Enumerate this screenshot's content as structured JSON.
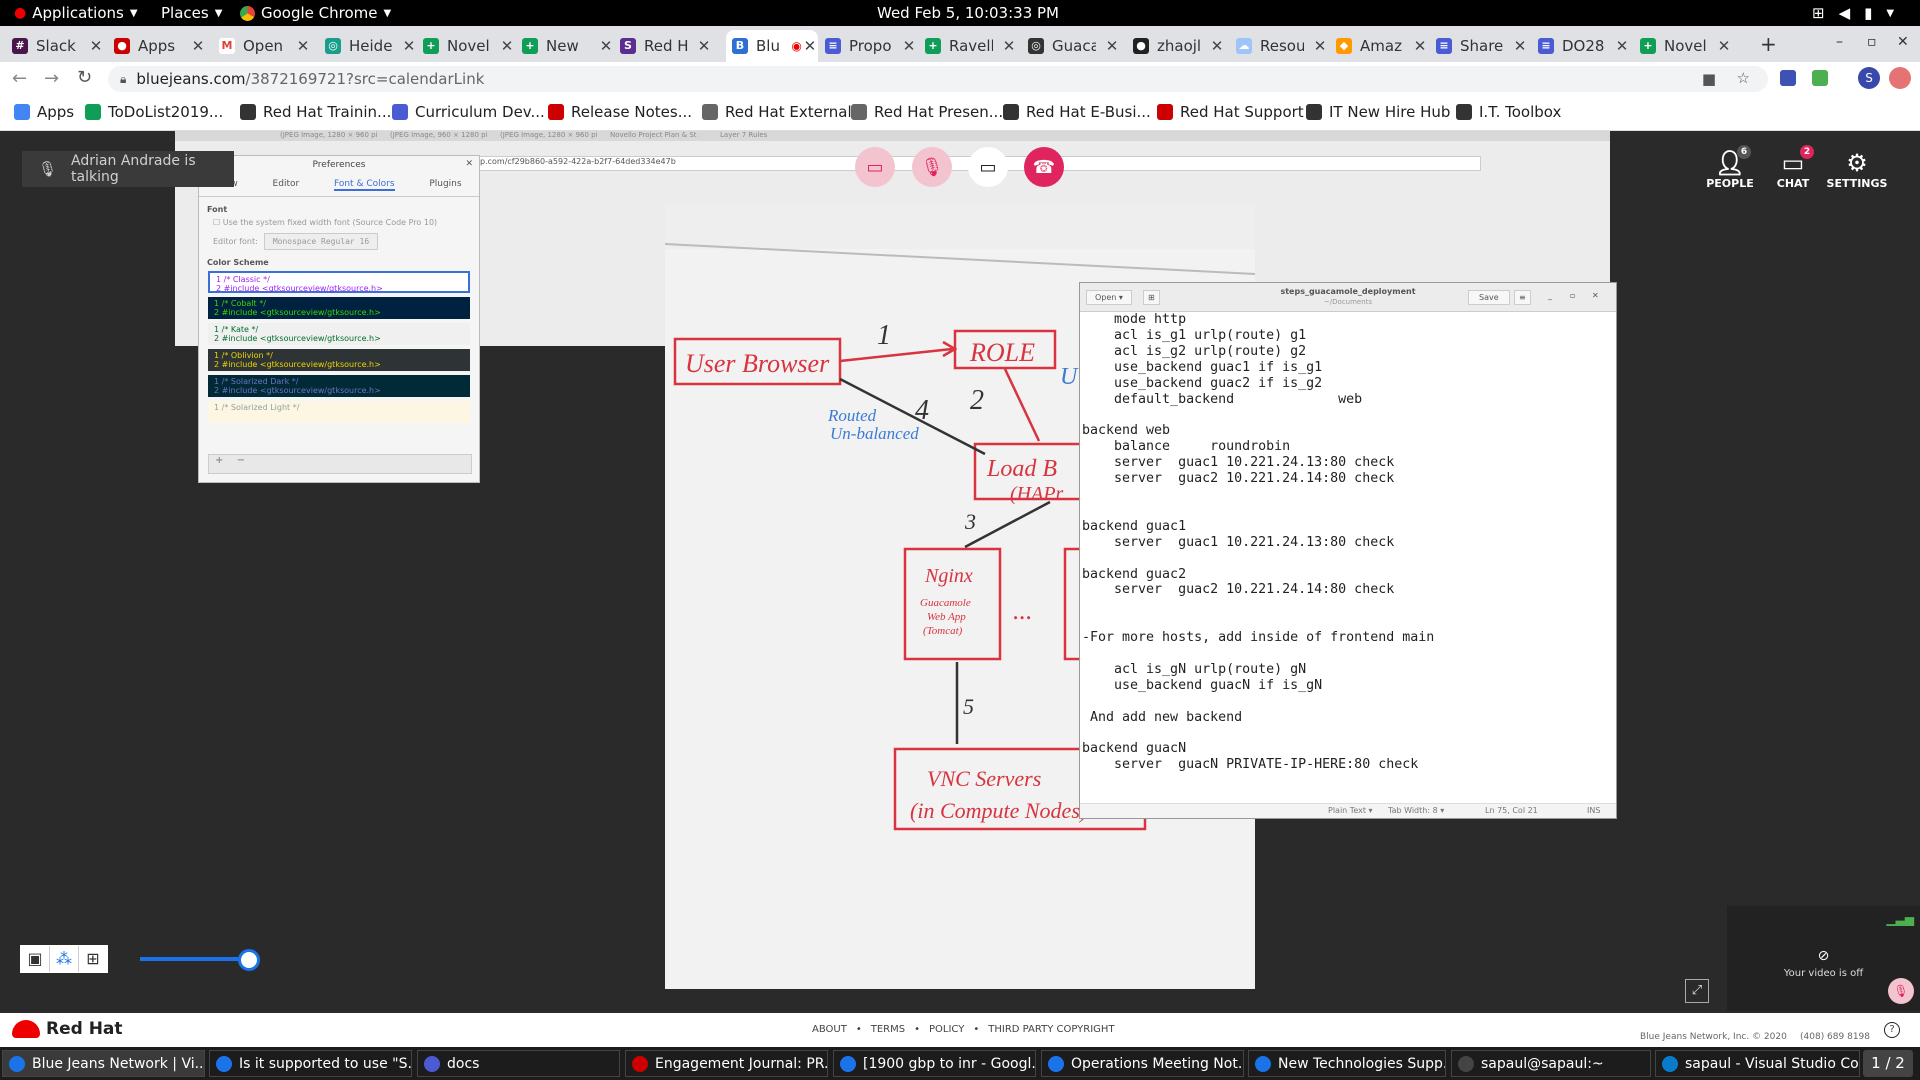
{
  "gnome": {
    "applications": "Applications",
    "places": "Places",
    "app": "Google Chrome",
    "clock": "Wed Feb  5, 10:03:33 PM"
  },
  "tabs": [
    {
      "label": "Slack",
      "color": "#4a154b",
      "glyph": "#"
    },
    {
      "label": "Apps",
      "color": "#cc0000",
      "glyph": "●"
    },
    {
      "label": "Open",
      "color": "#ffffff",
      "glyph": "M"
    },
    {
      "label": "Heide",
      "color": "#1a9e8a",
      "glyph": "◎"
    },
    {
      "label": "Novel",
      "color": "#0f9d58",
      "glyph": "+"
    },
    {
      "label": "New",
      "color": "#0f9d58",
      "glyph": "+"
    },
    {
      "label": "Red H",
      "color": "#5c2d91",
      "glyph": "S"
    },
    {
      "label": "Blu",
      "color": "#2d6fd3",
      "glyph": "B"
    },
    {
      "label": "Propo",
      "color": "#4a5bd4",
      "glyph": "≡"
    },
    {
      "label": "Ravell",
      "color": "#0f9d58",
      "glyph": "+"
    },
    {
      "label": "Guaca",
      "color": "#333333",
      "glyph": "◎"
    },
    {
      "label": "zhaojl",
      "color": "#222222",
      "glyph": "●"
    },
    {
      "label": "Resou",
      "color": "#9fc5f8",
      "glyph": "☁"
    },
    {
      "label": "Amaz",
      "color": "#ff9900",
      "glyph": "◆"
    },
    {
      "label": "Share",
      "color": "#4a5bd4",
      "glyph": "≡"
    },
    {
      "label": "DO28",
      "color": "#4a5bd4",
      "glyph": "≡"
    },
    {
      "label": "Novel",
      "color": "#0f9d58",
      "glyph": "+"
    }
  ],
  "url": {
    "host": "bluejeans.com",
    "path": "/387216972​1?src=calendarLink"
  },
  "bookmarks": [
    {
      "label": "Apps",
      "color": "#4285f4"
    },
    {
      "label": "ToDoList2019...",
      "color": "#0f9d58"
    },
    {
      "label": "Red Hat Trainin...",
      "color": "#333333"
    },
    {
      "label": "Curriculum Dev...",
      "color": "#4a5bd4"
    },
    {
      "label": "Release Notes...",
      "color": "#cc0000"
    },
    {
      "label": "Red Hat External",
      "color": "#666666"
    },
    {
      "label": "Red Hat Presen...",
      "color": "#666666"
    },
    {
      "label": "Red Hat E-Busi...",
      "color": "#333333"
    },
    {
      "label": "Red Hat Support",
      "color": "#cc0000"
    },
    {
      "label": "IT New Hire Hub",
      "color": "#333333"
    },
    {
      "label": "I.T. Toolbox",
      "color": "#333333"
    }
  ],
  "meeting": {
    "talking": "Adrian Andrade is talking",
    "people": "PEOPLE",
    "people_count": "6",
    "chat": "CHAT",
    "chat_count": "2",
    "settings": "SETTINGS",
    "video_off": "Your video is off"
  },
  "shared": {
    "inner_tabs": [
      "(JPEG Image, 1280 × 960 pi",
      "(JPEG Image, 960 × 1280 pi",
      "(JPEG Image, 1280 × 960 pi",
      "Novello Project Plan & St",
      "Layer 7 Rules"
    ],
    "inner_url": "p.com/cf29b860-a592-422a-b2f7-64ded334e47b",
    "prefs": {
      "title": "Preferences",
      "tabs": [
        "View",
        "Editor",
        "Font & Colors",
        "Plugins"
      ],
      "font_heading": "Font",
      "system_font": "Use the system fixed width font (Source Code Pro 10)",
      "editor_font_label": "Editor font:",
      "editor_font_value": "Monospace Regular  16",
      "scheme_heading": "Color Scheme",
      "schemes": [
        {
          "l1": "1 /* Classic */",
          "l2": "2 #include <gtksourceview/gtksource.h>",
          "bg": "#ffffff",
          "fg": "#a020f0"
        },
        {
          "l1": "1 /* Cobalt */",
          "l2": "2 #include <gtksourceview/gtksource.h>",
          "bg": "#002240",
          "fg": "#3ad900"
        },
        {
          "l1": "1 /* Kate */",
          "l2": "2 #include <gtksourceview/gtksource.h>",
          "bg": "#f0f0f0",
          "fg": "#006e28"
        },
        {
          "l1": "1 /* Oblivion */",
          "l2": "2 #include <gtksourceview/gtksource.h>",
          "bg": "#2e3436",
          "fg": "#edd400"
        },
        {
          "l1": "1 /* Solarized Dark */",
          "l2": "2 #include <gtksourceview/gtksource.h>",
          "bg": "#002b36",
          "fg": "#6c71c4"
        },
        {
          "l1": "1 /* Solarized Light */",
          "l2": "",
          "bg": "#fdf6e3",
          "fg": "#93a1a1"
        }
      ]
    },
    "whiteboard": {
      "user_browser": "User Browser",
      "role": "ROLE",
      "load_balancer": "Load B",
      "load_balancer_sub": "(HAPr",
      "nginx": "Nginx",
      "nginx_sub1": "Guacamole",
      "nginx_sub2": "Web App",
      "nginx_sub3": "(Tomcat)",
      "ellipsis": "...",
      "vnc1": "VNC Servers",
      "vnc2": "(in Compute Nodes)",
      "routed1": "Routed",
      "routed2": "Un-balanced",
      "n1": "1",
      "n2": "2",
      "n3": "3",
      "n4": "4",
      "n5": "5",
      "u": "U"
    },
    "editor": {
      "open": "Open",
      "title": "steps_guacamole_deployment",
      "subtitle": "~/Documents",
      "save": "Save",
      "text": "    mode http\n    acl is_g1 urlp(route) g1\n    acl is_g2 urlp(route) g2\n    use_backend guac1 if is_g1\n    use_backend guac2 if is_g2\n    default_backend             web\n\nbackend web\n    balance     roundrobin\n    server  guac1 10.221.24.13:80 check\n    server  guac2 10.221.24.14:80 check\n\n\nbackend guac1\n    server  guac1 10.221.24.13:80 check\n\nbackend guac2\n    server  guac2 10.221.24.14:80 check\n\n\n-For more hosts, add inside of frontend main\n\n    acl is_gN urlp(route) gN\n    use_backend guacN if is_gN\n\n And add new backend\n\nbackend guacN\n    server  guacN PRIVATE-IP-HERE:80 check",
      "mode": "Plain Text ▾",
      "tabwidth": "Tab Width: 8 ▾",
      "pos": "Ln 75, Col 21",
      "ins": "INS"
    }
  },
  "footer": {
    "brand": "Red Hat",
    "links": [
      "ABOUT",
      "TERMS",
      "POLICY",
      "THIRD PARTY COPYRIGHT"
    ],
    "copyright": "Blue Jeans Network, Inc. © 2020",
    "phone": "(408) 689 8198"
  },
  "taskbar": [
    {
      "label": "Blue Jeans Network | Vi...",
      "color": "#1a73e8"
    },
    {
      "label": "Is it supported to use \"S...",
      "color": "#1a73e8"
    },
    {
      "label": "docs",
      "color": "#4a5bd4"
    },
    {
      "label": "Engagement Journal: PR...",
      "color": "#cc0000"
    },
    {
      "label": "[1900 gbp to inr - Googl...",
      "color": "#1a73e8"
    },
    {
      "label": "Operations Meeting Not...",
      "color": "#1a73e8"
    },
    {
      "label": "New Technologies Supp...",
      "color": "#1a73e8"
    },
    {
      "label": "sapaul@sapaul:~",
      "color": "#444444"
    },
    {
      "label": "sapaul - Visual Studio Co...",
      "color": "#0a7acc"
    }
  ],
  "workspace": "1 / 2"
}
